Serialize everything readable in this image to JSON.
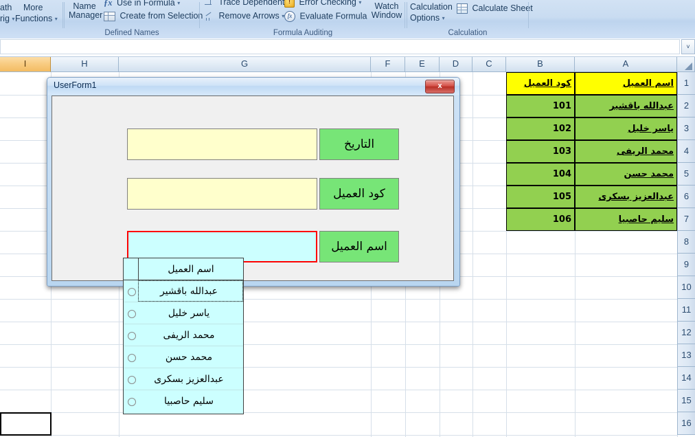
{
  "ribbon": {
    "groups": [
      {
        "label": "",
        "items": [
          {
            "label": "ath",
            "icon": "math-trig-icon"
          },
          {
            "label": "rig",
            "icon": "math-trig-dropdown-icon"
          },
          {
            "label": "More",
            "icon": "more-functions-icon"
          },
          {
            "label": "Functions",
            "icon": "more-functions-dropdown-icon"
          }
        ]
      },
      {
        "label": "Defined Names",
        "items": [
          {
            "label": "Name",
            "icon": "name-manager-icon"
          },
          {
            "label": "Manager",
            "icon": "name-manager-icon"
          },
          {
            "label": "Use in Formula",
            "icon": "fx-icon"
          },
          {
            "label": "Create from Selection",
            "icon": "create-from-selection-icon"
          }
        ]
      },
      {
        "label": "Formula Auditing",
        "items": [
          {
            "label": "Trace Dependents",
            "icon": "trace-dependents-icon"
          },
          {
            "label": "Remove Arrows",
            "icon": "remove-arrows-icon"
          },
          {
            "label": "Error Checking",
            "icon": "error-checking-icon"
          },
          {
            "label": "Evaluate Formula",
            "icon": "evaluate-formula-icon"
          }
        ]
      },
      {
        "label": "",
        "items": [
          {
            "label": "Watch",
            "icon": "watch-window-icon"
          },
          {
            "label": "Window",
            "icon": "watch-window-icon"
          }
        ]
      },
      {
        "label": "Calculation",
        "items": [
          {
            "label": "Calculation",
            "icon": "calculation-options-icon"
          },
          {
            "label": "Options",
            "icon": "calculation-options-dropdown-icon"
          },
          {
            "label": "Calculate Sheet",
            "icon": "calculate-sheet-icon"
          }
        ]
      }
    ],
    "labels": {
      "math_trig_1": "ath",
      "math_trig_2": "rig",
      "more_1": "More",
      "more_2": "Functions",
      "name_mgr_1": "Name",
      "name_mgr_2": "Manager",
      "use_in_formula": "Use in Formula",
      "create_from_selection": "Create from Selection",
      "defined_names": "Defined Names",
      "trace_dependents": "Trace Dependents",
      "remove_arrows": "Remove Arrows",
      "error_checking": "Error Checking",
      "evaluate_formula": "Evaluate Formula",
      "formula_auditing": "Formula Auditing",
      "watch_1": "Watch",
      "watch_2": "Window",
      "calc_opt_1": "Calculation",
      "calc_opt_2": "Options",
      "calculate_sheet": "Calculate Sheet",
      "calculation": "Calculation"
    }
  },
  "formula_bar": {
    "name_box_value": "",
    "formula_value": "",
    "expand_glyph": "˅"
  },
  "sheet": {
    "column_headers": [
      "I",
      "H",
      "G",
      "F",
      "E",
      "D",
      "C",
      "B",
      "A"
    ],
    "selected_column": "I",
    "row_headers": [
      "1",
      "2",
      "3",
      "4",
      "5",
      "6",
      "7",
      "8",
      "9",
      "10",
      "11",
      "12",
      "13",
      "14",
      "15",
      "16"
    ],
    "table": {
      "header": {
        "col_a": "اسم العميل",
        "col_b": "كود العميل"
      },
      "rows": [
        {
          "name": "عبدالله باقشير",
          "code": "101"
        },
        {
          "name": "ياسر خليل",
          "code": "102"
        },
        {
          "name": "محمد الريفى",
          "code": "103"
        },
        {
          "name": "محمد حسن",
          "code": "104"
        },
        {
          "name": "عبدالعزيز بسكرى",
          "code": "105"
        },
        {
          "name": "سليم حاصبيا",
          "code": "106"
        }
      ]
    },
    "colors": {
      "header_fill": "#ffff00",
      "data_fill": "#92d050",
      "selected_header": "#f3bc63"
    }
  },
  "userform": {
    "title": "UserForm1",
    "close_label": "x",
    "fields": [
      {
        "label": "التاريخ",
        "value": "",
        "type": "textbox"
      },
      {
        "label": "كود العميل",
        "value": "",
        "type": "textbox"
      },
      {
        "label": "اسم العميل",
        "value": "",
        "type": "combobox"
      }
    ],
    "label_date": "التاريخ",
    "label_code": "كود العميل",
    "label_name": "اسم العميل",
    "date_value": "",
    "code_value": "",
    "name_value": "",
    "colors": {
      "label_fill": "#77e577",
      "textbox_fill": "#ffffcc",
      "combo_fill": "#ccffff",
      "combo_focus_border": "#ff0000",
      "close_button": "#b82f25"
    }
  },
  "dropdown": {
    "header": "اسم العميل",
    "items": [
      {
        "text": "عبدالله باقشير",
        "focused": true
      },
      {
        "text": "ياسر خليل",
        "focused": false
      },
      {
        "text": "محمد الريفى",
        "focused": false
      },
      {
        "text": "محمد حسن",
        "focused": false
      },
      {
        "text": "عبدالعزيز بسكرى",
        "focused": false
      },
      {
        "text": "سليم حاصبيا",
        "focused": false
      }
    ]
  }
}
